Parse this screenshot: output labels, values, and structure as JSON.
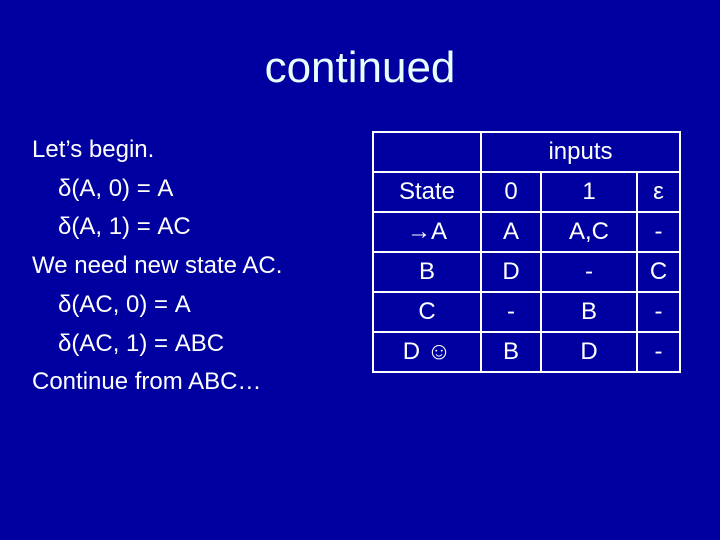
{
  "slide": {
    "title": "continued",
    "background_color": "#0000A0",
    "text_color": "#FFFFFF"
  },
  "body": {
    "lines": [
      {
        "text": "Let’s begin.",
        "indent": 0
      },
      {
        "text": "δ(A, 0) = A",
        "indent": 1
      },
      {
        "text": "δ(A, 1) = AC",
        "indent": 1
      },
      {
        "text": "We need new state AC.",
        "indent": 0
      },
      {
        "text": "δ(AC, 0) = A",
        "indent": 1
      },
      {
        "text": "δ(AC, 1) = ABC",
        "indent": 1
      },
      {
        "text": "Continue from ABC…",
        "indent": 0
      }
    ]
  },
  "table": {
    "group_header": "inputs",
    "columns": [
      "State",
      "0",
      "1",
      "ε"
    ],
    "rows": [
      {
        "state": "→A",
        "input_0": "A",
        "input_1": "A,C",
        "epsilon": "-"
      },
      {
        "state": "B",
        "input_0": "D",
        "input_1": "-",
        "epsilon": "C"
      },
      {
        "state": "C",
        "input_0": "-",
        "input_1": "B",
        "epsilon": "-"
      },
      {
        "state": "D ☺",
        "input_0": "B",
        "input_1": "D",
        "epsilon": "-"
      }
    ]
  }
}
